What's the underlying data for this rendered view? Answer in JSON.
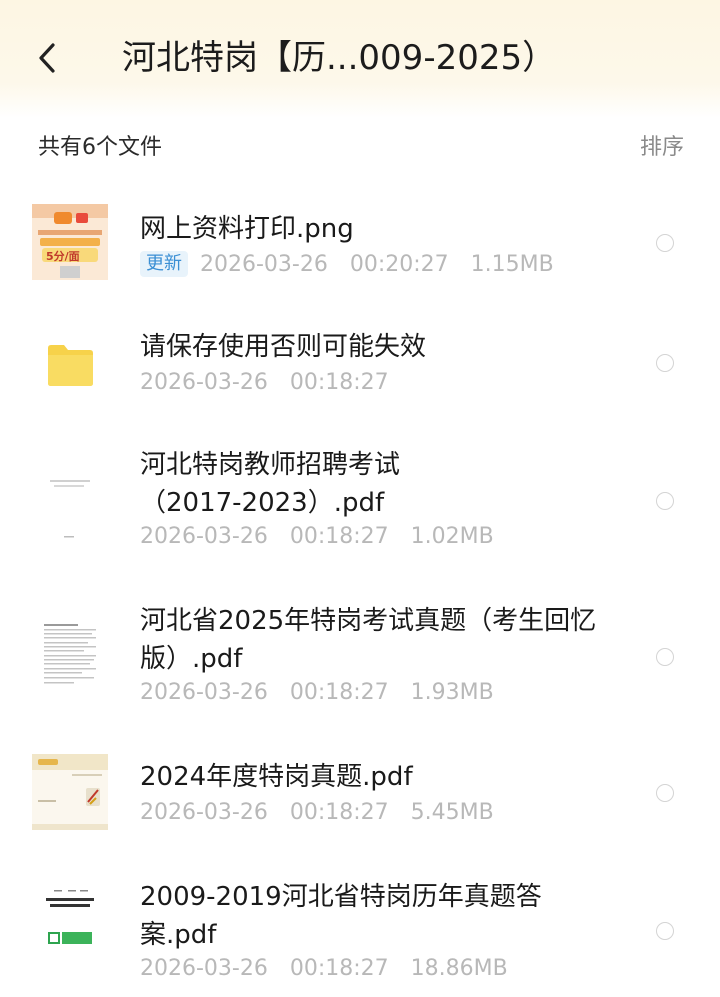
{
  "header": {
    "title": "河北特岗【历...009-2025）",
    "back_icon": "chevron-left-icon"
  },
  "summary": {
    "count_text": "共有6个文件",
    "sort_label": "排序"
  },
  "files": [
    {
      "name": "网上资料打印.png",
      "badge": "更新",
      "date": "2026-03-26",
      "time": "00:20:27",
      "size": "1.15MB",
      "thumb": "image-thumbnail"
    },
    {
      "name": "请保存使用否则可能失效",
      "date": "2026-03-26",
      "time": "00:18:27",
      "thumb": "folder-icon"
    },
    {
      "name": "河北特岗教师招聘考试（2017-2023）.pdf",
      "date": "2026-03-26",
      "time": "00:18:27",
      "size": "1.02MB",
      "thumb": "pdf-thumbnail"
    },
    {
      "name": "河北省2025年特岗考试真题（考生回忆版）.pdf",
      "date": "2026-03-26",
      "time": "00:18:27",
      "size": "1.93MB",
      "thumb": "pdf-thumbnail"
    },
    {
      "name": "2024年度特岗真题.pdf",
      "date": "2026-03-26",
      "time": "00:18:27",
      "size": "5.45MB",
      "thumb": "pdf-thumbnail"
    },
    {
      "name": "2009-2019河北省特岗历年真题答案.pdf",
      "date": "2026-03-26",
      "time": "00:18:27",
      "size": "18.86MB",
      "thumb": "pdf-thumbnail"
    }
  ],
  "colors": {
    "header_bg": "#fdf6e3",
    "folder": "#f7d24a",
    "badge_text": "#3b8fd4",
    "meta_text": "#b8b8b8"
  }
}
